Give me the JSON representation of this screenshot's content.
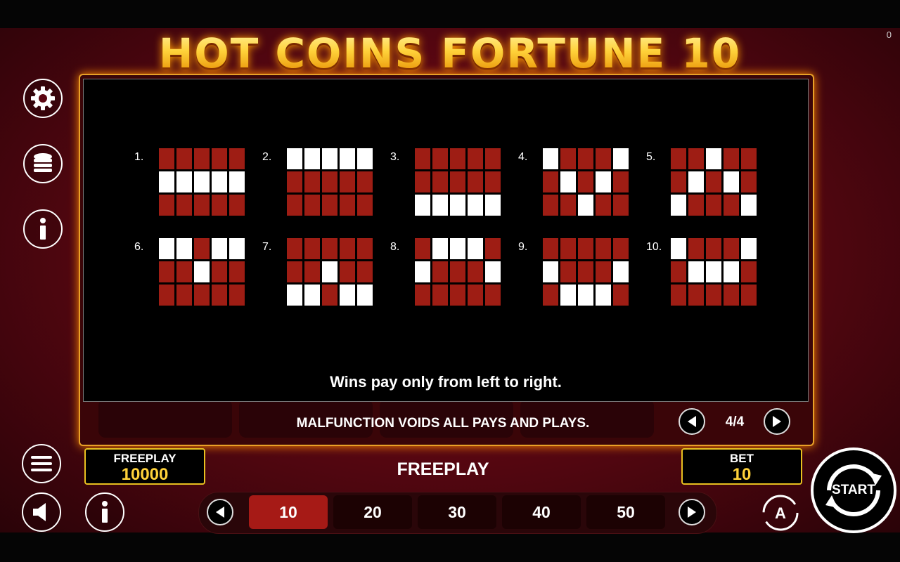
{
  "counter": "0",
  "title": "HOT COINS FORTUNE 10",
  "paylines": [
    {
      "label": "1.",
      "rows": [
        "RRRRR",
        "WWWWW",
        "RRRRR"
      ]
    },
    {
      "label": "2.",
      "rows": [
        "WWWWW",
        "RRRRR",
        "RRRRR"
      ]
    },
    {
      "label": "3.",
      "rows": [
        "RRRRR",
        "RRRRR",
        "WWWWW"
      ]
    },
    {
      "label": "4.",
      "rows": [
        "WRRRW",
        "RWRWR",
        "RRWRR"
      ]
    },
    {
      "label": "5.",
      "rows": [
        "RRWRR",
        "RWRWR",
        "WRRRW"
      ]
    },
    {
      "label": "6.",
      "rows": [
        "WWRWW",
        "RRWRR",
        "RRRRR"
      ]
    },
    {
      "label": "7.",
      "rows": [
        "RRRRR",
        "RRWRR",
        "WWRWW"
      ]
    },
    {
      "label": "8.",
      "rows": [
        "RWWWR",
        "WRRRW",
        "RRRRR"
      ]
    },
    {
      "label": "9.",
      "rows": [
        "RRRRR",
        "WRRRW",
        "RWWWR"
      ]
    },
    {
      "label": "10.",
      "rows": [
        "WRRRW",
        "RWWWR",
        "RRRRR"
      ]
    }
  ],
  "paytable": {
    "wins_note": "Wins pay only from left to right.",
    "malfunction": "MALFUNCTION VOIDS ALL PAYS AND PLAYS.",
    "page": "4/4"
  },
  "credit": {
    "label": "FREEPLAY",
    "value": "10000"
  },
  "mode_label": "FREEPLAY",
  "bet": {
    "label": "BET",
    "value": "10"
  },
  "bet_options": [
    "10",
    "20",
    "30",
    "40",
    "50"
  ],
  "selected_bet_index": 0,
  "start_label": "START",
  "colors": {
    "cell_red": "#9e1d14",
    "cell_white": "#ffffff",
    "accent_gold": "#e8c020",
    "selected": "#a61a16"
  },
  "icons": {
    "settings": "gear-icon",
    "coins": "coin-stack-icon",
    "info": "info-icon",
    "menu": "menu-icon",
    "sound": "speaker-icon",
    "autoplay": "autoplay-icon"
  }
}
